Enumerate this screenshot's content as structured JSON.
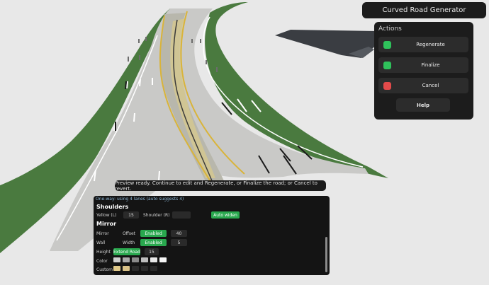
{
  "window": {
    "title": "Curved Road Generator"
  },
  "actions": {
    "header": "Actions",
    "buttons": [
      {
        "label": "Regenerate",
        "color": "#2fc25b"
      },
      {
        "label": "Finalize",
        "color": "#2fc25b"
      },
      {
        "label": "Cancel",
        "color": "#e24a4a"
      }
    ],
    "help_label": "Help"
  },
  "tooltip": "Preview ready. Continue to edit and Regenerate, or Finalize the road; or Cancel to revert.",
  "settings": {
    "status": "One-way: using 4 lanes (auto suggests 4)",
    "shoulders": {
      "title": "Shoulders",
      "yellow_label": "Yellow (L)",
      "yellow_value": "15",
      "shoulder_label": "Shoulder (R)",
      "shoulder_value": "",
      "auto_widen_label": "Auto widen"
    },
    "mirror": {
      "title": "Mirror",
      "mirror_label": "Mirror",
      "offset_label": "Offset",
      "offset_state": "Enabled",
      "offset_value": "40",
      "wall_label": "Wall",
      "width_label": "Width",
      "width_state": "Enabled",
      "width_value": "5",
      "height_label": "Height",
      "extend_road_label": "Extend Road",
      "height_value": "15",
      "color_label": "Color",
      "custom_label": "Custom",
      "color_swatches": [
        "#cfcfcf",
        "#a9a9a9",
        "#8a8a8a",
        "#bdbdbd",
        "#e9e9e9",
        "#f6f6f6"
      ],
      "custom_swatches": [
        "#e0c98a",
        "#d9c288",
        "#2a2a2a",
        "#2a2a2a",
        "#2a2a2a"
      ]
    }
  },
  "colors": {
    "accent_green": "#29a84e",
    "danger_red": "#e24a4a",
    "panel_bg": "#1c1c1c"
  }
}
